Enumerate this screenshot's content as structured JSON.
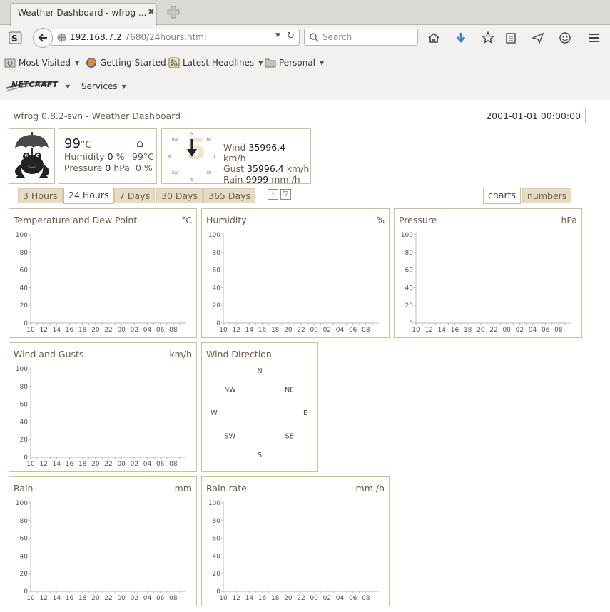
{
  "browser": {
    "tab_title": "Weather Dashboard - wfrog ...",
    "url_host": "192.168.7.2",
    "url_path": ":7680/24hours.html",
    "search_placeholder": "Search"
  },
  "bookmarks": [
    {
      "label": "Most Visited",
      "dropdown": true
    },
    {
      "label": "Getting Started",
      "dropdown": false
    },
    {
      "label": "Latest Headlines",
      "dropdown": true
    },
    {
      "label": "Personal",
      "dropdown": true
    }
  ],
  "netcraft": {
    "logo": "NETCRAFT",
    "services_label": "Services"
  },
  "header": {
    "title": "wfrog 0.8.2-svn - Weather Dashboard",
    "datetime": "2001-01-01 00:00:00"
  },
  "current": {
    "temp_value": "99",
    "temp_unit": "°C",
    "home_icon": "home-icon",
    "humidity_label": "Humidity",
    "humidity_value": "0",
    "humidity_unit": "%",
    "indoor_temp": "99°C",
    "pressure_label": "Pressure",
    "pressure_value": "0",
    "pressure_unit": "hPa",
    "indoor_humidity": "0 %"
  },
  "wind": {
    "wind_label": "Wind",
    "wind_value": "35996.4",
    "wind_unit": "km/h",
    "gust_label": "Gust",
    "gust_value": "35996.4",
    "gust_unit": "km/h",
    "rain_label": "Rain",
    "rain_value": "9999",
    "rain_unit": "mm /h",
    "compass_labels": [
      "N",
      "NE",
      "E",
      "SE",
      "S",
      "SW",
      "W",
      "NW"
    ]
  },
  "ranges": [
    "3 Hours",
    "24 Hours",
    "7 Days",
    "30 Days",
    "365 Days"
  ],
  "active_range": "24 Hours",
  "views": [
    "charts",
    "numbers"
  ],
  "active_view": "charts",
  "colors": {
    "border": "#c9bf9d",
    "tab_bg": "#e5dcc3",
    "title": "#6a5a48"
  },
  "charts": [
    {
      "title": "Temperature and Dew Point",
      "unit": "°C"
    },
    {
      "title": "Humidity",
      "unit": "%"
    },
    {
      "title": "Pressure",
      "unit": "hPa"
    },
    {
      "title": "Wind and Gusts",
      "unit": "km/h"
    },
    {
      "title": "Wind Direction",
      "unit": ""
    },
    {
      "title": "Rain",
      "unit": "mm"
    },
    {
      "title": "Rain rate",
      "unit": "mm /h"
    }
  ],
  "chart_data": [
    {
      "type": "line",
      "title": "Temperature and Dew Point",
      "ylabel": "°C",
      "ylim": [
        0,
        100
      ],
      "y_ticks": [
        0,
        20,
        40,
        60,
        80,
        100
      ],
      "x_ticks": [
        "10",
        "12",
        "14",
        "16",
        "18",
        "20",
        "22",
        "00",
        "02",
        "04",
        "06",
        "08"
      ],
      "series": []
    },
    {
      "type": "line",
      "title": "Humidity",
      "ylabel": "%",
      "ylim": [
        0,
        100
      ],
      "y_ticks": [
        0,
        20,
        40,
        60,
        80,
        100
      ],
      "x_ticks": [
        "10",
        "12",
        "14",
        "16",
        "18",
        "20",
        "22",
        "00",
        "02",
        "04",
        "06",
        "08"
      ],
      "series": []
    },
    {
      "type": "line",
      "title": "Pressure",
      "ylabel": "hPa",
      "ylim": [
        0,
        100
      ],
      "y_ticks": [
        0,
        20,
        40,
        60,
        80,
        100
      ],
      "x_ticks": [
        "10",
        "12",
        "14",
        "16",
        "18",
        "20",
        "22",
        "00",
        "02",
        "04",
        "06",
        "08"
      ],
      "series": []
    },
    {
      "type": "line",
      "title": "Wind and Gusts",
      "ylabel": "km/h",
      "ylim": [
        0,
        100
      ],
      "y_ticks": [
        0,
        20,
        40,
        60,
        80,
        100
      ],
      "x_ticks": [
        "10",
        "12",
        "14",
        "16",
        "18",
        "20",
        "22",
        "00",
        "02",
        "04",
        "06",
        "08"
      ],
      "series": []
    },
    {
      "type": "scatter",
      "title": "Wind Direction",
      "directions": [
        "N",
        "NE",
        "E",
        "SE",
        "S",
        "SW",
        "W",
        "NW"
      ],
      "series": []
    },
    {
      "type": "bar",
      "title": "Rain",
      "ylabel": "mm",
      "ylim": [
        0,
        100
      ],
      "y_ticks": [
        0,
        20,
        40,
        60,
        80,
        100
      ],
      "x_ticks": [
        "10",
        "12",
        "14",
        "16",
        "18",
        "20",
        "22",
        "00",
        "02",
        "04",
        "06",
        "08"
      ],
      "series": []
    },
    {
      "type": "line",
      "title": "Rain rate",
      "ylabel": "mm /h",
      "ylim": [
        0,
        100
      ],
      "y_ticks": [
        0,
        20,
        40,
        60,
        80,
        100
      ],
      "x_ticks": [
        "10",
        "12",
        "14",
        "16",
        "18",
        "20",
        "22",
        "00",
        "02",
        "04",
        "06",
        "08"
      ],
      "series": []
    }
  ]
}
